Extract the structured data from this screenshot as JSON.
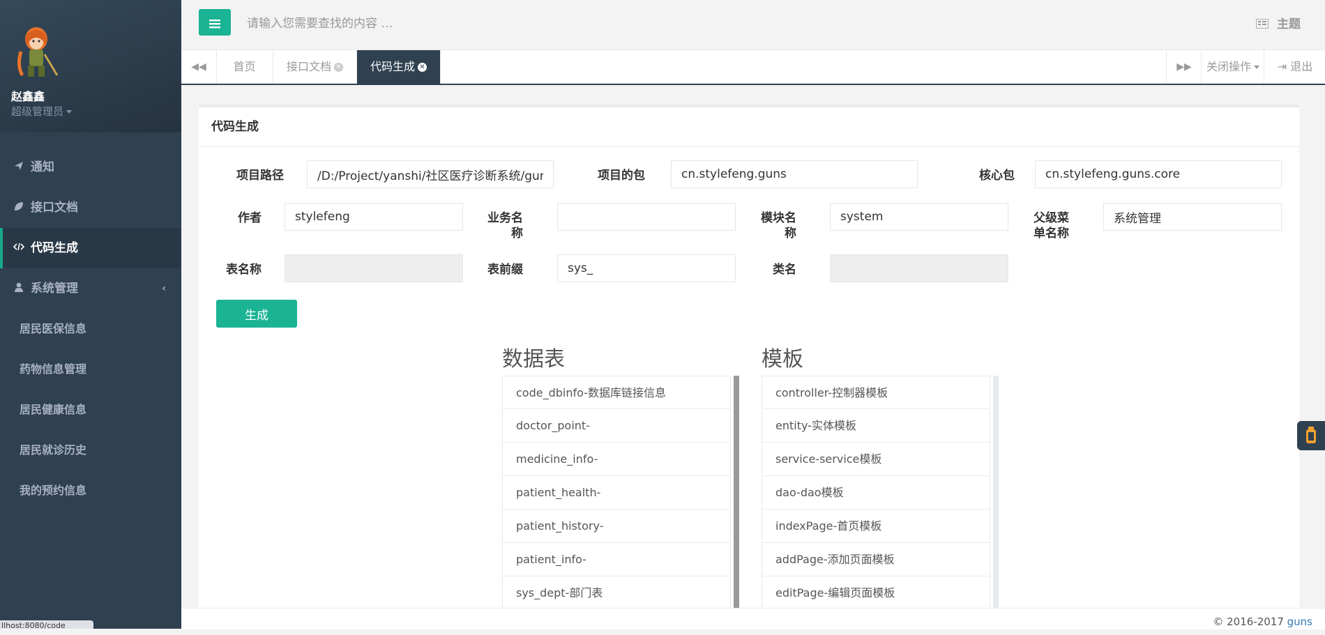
{
  "profile": {
    "name": "赵鑫鑫",
    "role": "超级管理员"
  },
  "sidebar": {
    "items": [
      {
        "label": "通知",
        "icon": "paper-plane-icon"
      },
      {
        "label": "接口文档",
        "icon": "leaf-icon"
      },
      {
        "label": "代码生成",
        "icon": "code-icon"
      },
      {
        "label": "系统管理",
        "icon": "user-icon"
      }
    ],
    "sub_items": [
      "居民医保信息",
      "药物信息管理",
      "居民健康信息",
      "居民就诊历史",
      "我的预约信息"
    ]
  },
  "topbar": {
    "search_placeholder": "请输入您需要查找的内容 …",
    "theme_label": "主题"
  },
  "tabs": {
    "items": [
      {
        "label": "首页",
        "closable": false
      },
      {
        "label": "接口文档",
        "closable": true
      },
      {
        "label": "代码生成",
        "closable": true,
        "active": true
      }
    ],
    "close_ops_label": "关闭操作",
    "logout_label": "退出"
  },
  "form": {
    "title": "代码生成",
    "fields": {
      "project_path": {
        "label": "项目路径",
        "value": "/D:/Project/yanshi/社区医疗诊断系统/guns"
      },
      "project_package": {
        "label": "项目的包",
        "value": "cn.stylefeng.guns"
      },
      "core_package": {
        "label": "核心包",
        "value": "cn.stylefeng.guns.core"
      },
      "author": {
        "label": "作者",
        "value": "stylefeng"
      },
      "biz_name": {
        "label_line1": "业务名",
        "label_line2": "称",
        "value": ""
      },
      "module_name": {
        "label_line1": "模块名",
        "label_line2": "称",
        "value": "system"
      },
      "parent_menu": {
        "label_line1": "父级菜",
        "label_line2": "单名称",
        "value": "系统管理"
      },
      "table_name": {
        "label": "表名称",
        "value": ""
      },
      "table_prefix": {
        "label": "表前缀",
        "value": "sys_"
      },
      "class_name": {
        "label": "类名",
        "value": ""
      }
    },
    "generate_label": "生成"
  },
  "tables": {
    "title": "数据表",
    "items": [
      "code_dbinfo-数据库链接信息",
      "doctor_point-",
      "medicine_info-",
      "patient_health-",
      "patient_history-",
      "patient_info-",
      "sys_dept-部门表"
    ]
  },
  "templates": {
    "title": "模板",
    "items": [
      "controller-控制器模板",
      "entity-实体模板",
      "service-service模板",
      "dao-dao模板",
      "indexPage-首页模板",
      "addPage-添加页面模板",
      "editPage-编辑页面模板"
    ]
  },
  "footer": {
    "copyright": "© 2016-2017 ",
    "link": "guns"
  },
  "status_url": "llhost:8080/code"
}
